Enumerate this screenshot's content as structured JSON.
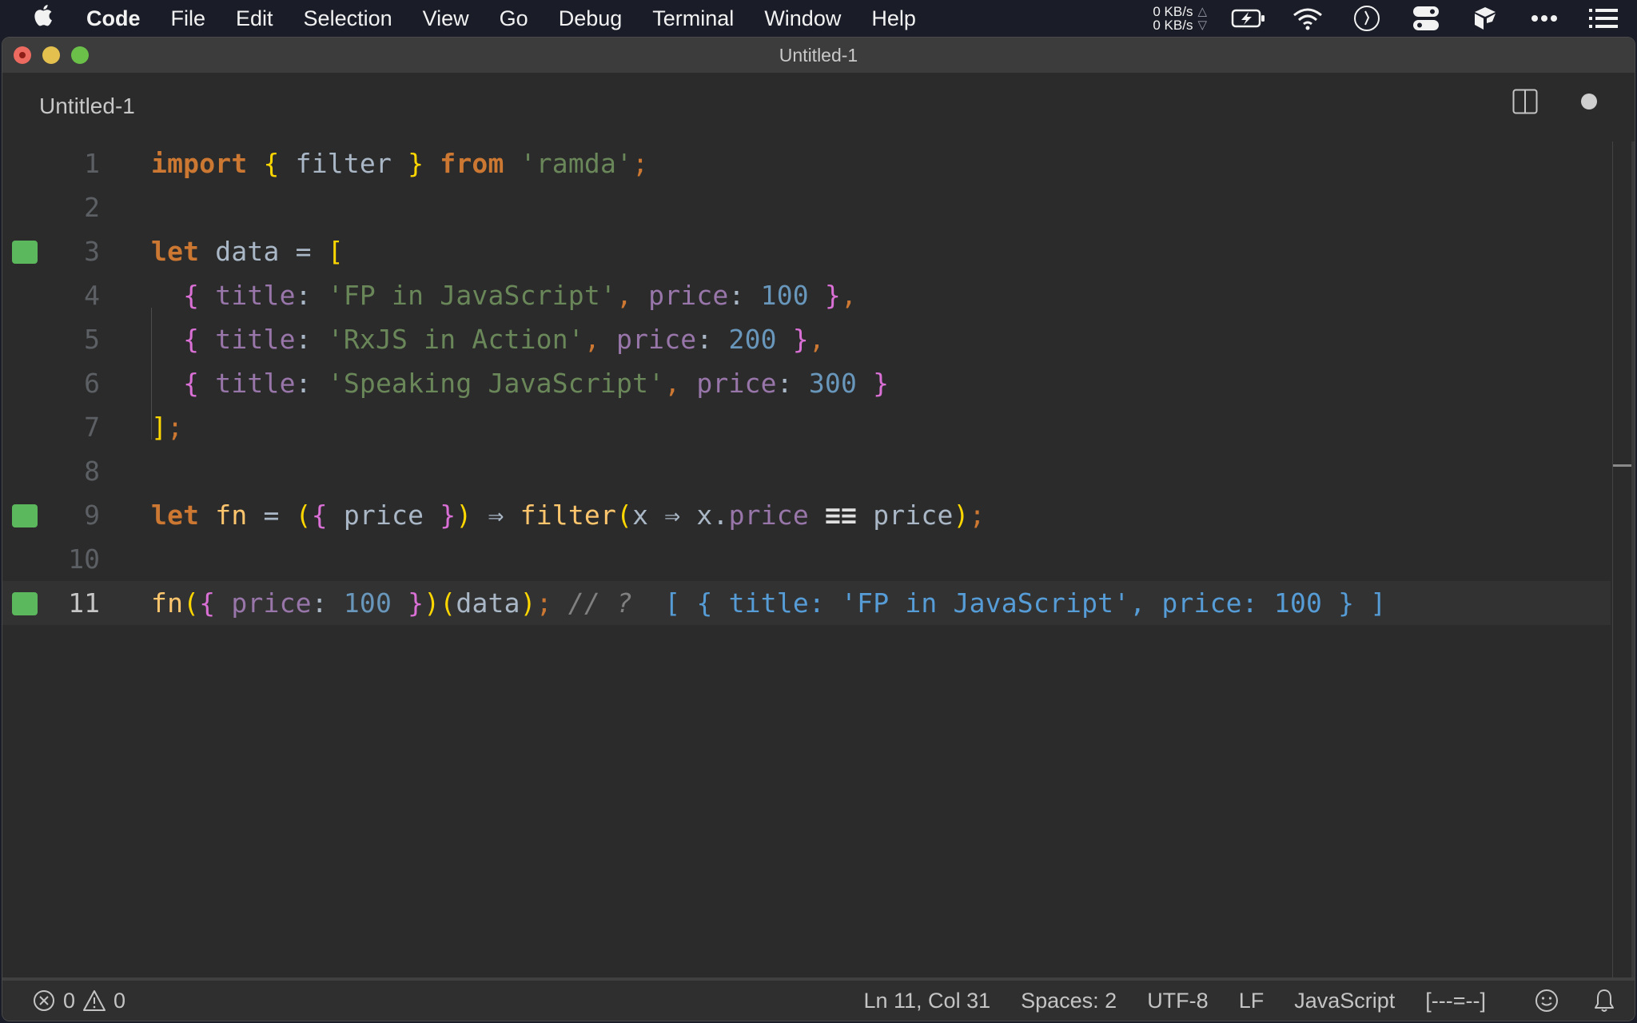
{
  "menubar": {
    "apple_icon": "apple-logo-icon",
    "app_name": "Code",
    "items": [
      "File",
      "Edit",
      "Selection",
      "View",
      "Go",
      "Debug",
      "Terminal",
      "Window",
      "Help"
    ],
    "net_up": "0 KB/s",
    "net_down": "0 KB/s",
    "status_icons": [
      "battery-charging-icon",
      "wifi-icon",
      "clock-icon",
      "toggle-switches-icon",
      "cube-icon",
      "more-dots-icon",
      "list-icon"
    ]
  },
  "window": {
    "title": "Untitled-1",
    "tab_label": "Untitled-1",
    "split_editor_icon": "split-editor-icon",
    "dirty_indicator_icon": "unsaved-dot-icon"
  },
  "editor": {
    "current_line": 11,
    "lines": [
      {
        "n": "1",
        "marker": false,
        "tokens": [
          [
            "kw",
            "import"
          ],
          [
            "plain",
            " "
          ],
          [
            "b1",
            "{"
          ],
          [
            "plain",
            " filter "
          ],
          [
            "b1",
            "}"
          ],
          [
            "plain",
            " "
          ],
          [
            "kw",
            "from"
          ],
          [
            "plain",
            " "
          ],
          [
            "str",
            "'ramda'"
          ],
          [
            "punc",
            ";"
          ]
        ]
      },
      {
        "n": "2",
        "marker": false,
        "tokens": []
      },
      {
        "n": "3",
        "marker": true,
        "tokens": [
          [
            "kw",
            "let"
          ],
          [
            "plain",
            " data = "
          ],
          [
            "b1",
            "["
          ]
        ]
      },
      {
        "n": "4",
        "marker": false,
        "tokens": [
          [
            "plain",
            "  "
          ],
          [
            "b2",
            "{"
          ],
          [
            "plain",
            " "
          ],
          [
            "prop",
            "title"
          ],
          [
            "plain",
            ": "
          ],
          [
            "str",
            "'FP in JavaScript'"
          ],
          [
            "punc",
            ","
          ],
          [
            "plain",
            " "
          ],
          [
            "prop",
            "price"
          ],
          [
            "plain",
            ": "
          ],
          [
            "num",
            "100"
          ],
          [
            "plain",
            " "
          ],
          [
            "b2",
            "}"
          ],
          [
            "punc",
            ","
          ]
        ]
      },
      {
        "n": "5",
        "marker": false,
        "tokens": [
          [
            "plain",
            "  "
          ],
          [
            "b2",
            "{"
          ],
          [
            "plain",
            " "
          ],
          [
            "prop",
            "title"
          ],
          [
            "plain",
            ": "
          ],
          [
            "str",
            "'RxJS in Action'"
          ],
          [
            "punc",
            ","
          ],
          [
            "plain",
            " "
          ],
          [
            "prop",
            "price"
          ],
          [
            "plain",
            ": "
          ],
          [
            "num",
            "200"
          ],
          [
            "plain",
            " "
          ],
          [
            "b2",
            "}"
          ],
          [
            "punc",
            ","
          ]
        ]
      },
      {
        "n": "6",
        "marker": false,
        "tokens": [
          [
            "plain",
            "  "
          ],
          [
            "b2",
            "{"
          ],
          [
            "plain",
            " "
          ],
          [
            "prop",
            "title"
          ],
          [
            "plain",
            ": "
          ],
          [
            "str",
            "'Speaking JavaScript'"
          ],
          [
            "punc",
            ","
          ],
          [
            "plain",
            " "
          ],
          [
            "prop",
            "price"
          ],
          [
            "plain",
            ": "
          ],
          [
            "num",
            "300"
          ],
          [
            "plain",
            " "
          ],
          [
            "b2",
            "}"
          ]
        ]
      },
      {
        "n": "7",
        "marker": false,
        "tokens": [
          [
            "b1",
            "]"
          ],
          [
            "punc",
            ";"
          ]
        ]
      },
      {
        "n": "8",
        "marker": false,
        "tokens": []
      },
      {
        "n": "9",
        "marker": true,
        "tokens": [
          [
            "kw",
            "let"
          ],
          [
            "plain",
            " "
          ],
          [
            "fnc",
            "fn"
          ],
          [
            "plain",
            " = "
          ],
          [
            "b1",
            "("
          ],
          [
            "b2",
            "{"
          ],
          [
            "plain",
            " price "
          ],
          [
            "b2",
            "}"
          ],
          [
            "b1",
            ")"
          ],
          [
            "plain",
            " "
          ],
          [
            "op",
            "⇒"
          ],
          [
            "plain",
            " "
          ],
          [
            "fnc",
            "filter"
          ],
          [
            "b1",
            "("
          ],
          [
            "plain",
            "x "
          ],
          [
            "op",
            "⇒"
          ],
          [
            "plain",
            " x."
          ],
          [
            "prop",
            "price"
          ],
          [
            "plain",
            " "
          ],
          [
            "eqq",
            "≡≡"
          ],
          [
            "plain",
            " price"
          ],
          [
            "b1",
            ")"
          ],
          [
            "punc",
            ";"
          ]
        ]
      },
      {
        "n": "10",
        "marker": false,
        "tokens": []
      },
      {
        "n": "11",
        "marker": true,
        "tokens": [
          [
            "fnc",
            "fn"
          ],
          [
            "b1",
            "("
          ],
          [
            "b2",
            "{"
          ],
          [
            "plain",
            " "
          ],
          [
            "prop",
            "price"
          ],
          [
            "plain",
            ": "
          ],
          [
            "num",
            "100"
          ],
          [
            "plain",
            " "
          ],
          [
            "b2",
            "}"
          ],
          [
            "b1",
            ")"
          ],
          [
            "b1",
            "("
          ],
          [
            "plain",
            "data"
          ],
          [
            "b1",
            ")"
          ],
          [
            "punc",
            ";"
          ],
          [
            "plain",
            " "
          ],
          [
            "cmt",
            "// ?"
          ],
          [
            "plain",
            "  "
          ],
          [
            "res",
            "[ { title: 'FP in JavaScript', price: 100 } ]"
          ]
        ]
      }
    ]
  },
  "statusbar": {
    "errors_icon": "error-circle-icon",
    "errors": "0",
    "warnings_icon": "warning-triangle-icon",
    "warnings": "0",
    "cursor_position": "Ln 11, Col 31",
    "indentation": "Spaces: 2",
    "encoding": "UTF-8",
    "eol": "LF",
    "language": "JavaScript",
    "extension_status": "[---=--]",
    "feedback_icon": "smiley-icon",
    "notifications_icon": "bell-icon"
  }
}
